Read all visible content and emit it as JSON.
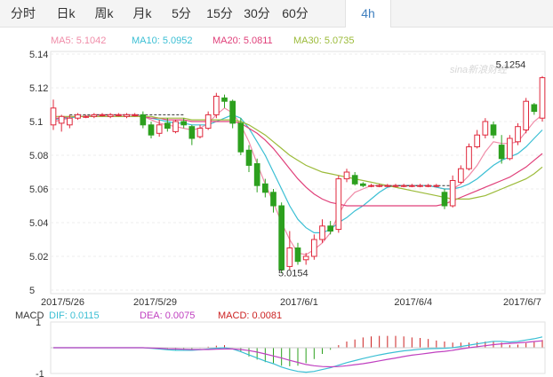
{
  "tabs": [
    "分时",
    "日k",
    "周k",
    "月k",
    "5分",
    "15分",
    "30分",
    "60分",
    "4h"
  ],
  "active_tab": 8,
  "legend": [
    {
      "label": "MA5: 5.1042",
      "color": "#f08ca8"
    },
    {
      "label": "MA10: 5.0952",
      "color": "#3bbfd4"
    },
    {
      "label": "MA20: 5.0811",
      "color": "#e0407a"
    },
    {
      "label": "MA30: 5.0735",
      "color": "#9cbb3a"
    }
  ],
  "macd_legend": [
    {
      "label": "MACD",
      "color": "#333333"
    },
    {
      "label": "DIF: 0.0115",
      "color": "#3bbfd4"
    },
    {
      "label": "DEA: 0.0075",
      "color": "#c040c0"
    },
    {
      "label": "MACD: 0.0081",
      "color": "#cc2222"
    }
  ],
  "watermark": "sina新浪财经",
  "chart_data": {
    "type": "candlestick",
    "y_ticks": [
      "5.14",
      "5.12",
      "5.1",
      "5.08",
      "5.06",
      "5.04",
      "5.02",
      "5"
    ],
    "ylim": [
      5.0,
      5.14
    ],
    "x_ticks": [
      {
        "label": "2017/5/26",
        "index": 0
      },
      {
        "label": "2017/5/29",
        "index": 12
      },
      {
        "label": "2017/6/1",
        "index": 30
      },
      {
        "label": "2017/6/4",
        "index": 44
      },
      {
        "label": "2017/6/7",
        "index": 59
      }
    ],
    "annotations": [
      {
        "label": "5.1254",
        "value": 5.1254,
        "index": 58
      },
      {
        "label": "5.0154",
        "value": 5.0154,
        "index": 30
      }
    ],
    "ref_lines": [
      {
        "value": 5.104,
        "from": 2,
        "to": 16
      },
      {
        "value": 5.062,
        "from": 39,
        "to": 49
      }
    ],
    "candles": [
      [
        5.098,
        5.108,
        5.113,
        5.095
      ],
      [
        5.099,
        5.103,
        5.104,
        5.094
      ],
      [
        5.098,
        5.102,
        5.104,
        5.096
      ],
      [
        5.102,
        5.104,
        5.105,
        5.101
      ],
      [
        5.103,
        5.103,
        5.104,
        5.102
      ],
      [
        5.103,
        5.104,
        5.105,
        5.102
      ],
      [
        5.104,
        5.104,
        5.105,
        5.103
      ],
      [
        5.103,
        5.104,
        5.105,
        5.102
      ],
      [
        5.104,
        5.104,
        5.105,
        5.103
      ],
      [
        5.103,
        5.104,
        5.105,
        5.102
      ],
      [
        5.104,
        5.104,
        5.105,
        5.103
      ],
      [
        5.104,
        5.098,
        5.106,
        5.096
      ],
      [
        5.098,
        5.092,
        5.1,
        5.09
      ],
      [
        5.093,
        5.098,
        5.101,
        5.091
      ],
      [
        5.099,
        5.096,
        5.102,
        5.094
      ],
      [
        5.094,
        5.1,
        5.101,
        5.093
      ],
      [
        5.1,
        5.098,
        5.102,
        5.096
      ],
      [
        5.097,
        5.09,
        5.098,
        5.086
      ],
      [
        5.091,
        5.096,
        5.098,
        5.09
      ],
      [
        5.096,
        5.104,
        5.106,
        5.095
      ],
      [
        5.104,
        5.115,
        5.117,
        5.102
      ],
      [
        5.114,
        5.112,
        5.116,
        5.108
      ],
      [
        5.112,
        5.099,
        5.113,
        5.096
      ],
      [
        5.099,
        5.082,
        5.102,
        5.08
      ],
      [
        5.083,
        5.074,
        5.086,
        5.07
      ],
      [
        5.075,
        5.062,
        5.078,
        5.058
      ],
      [
        5.063,
        5.058,
        5.066,
        5.055
      ],
      [
        5.058,
        5.05,
        5.06,
        5.046
      ],
      [
        5.05,
        5.012,
        5.052,
        5.01
      ],
      [
        5.014,
        5.025,
        5.035,
        5.012
      ],
      [
        5.025,
        5.017,
        5.028,
        5.015
      ],
      [
        5.018,
        5.02,
        5.022,
        5.015
      ],
      [
        5.02,
        5.03,
        5.033,
        5.018
      ],
      [
        5.03,
        5.038,
        5.042,
        5.028
      ],
      [
        5.038,
        5.035,
        5.041,
        5.033
      ],
      [
        5.036,
        5.066,
        5.068,
        5.034
      ],
      [
        5.066,
        5.07,
        5.072,
        5.064
      ],
      [
        5.068,
        5.063,
        5.07,
        5.062
      ],
      [
        5.063,
        5.062,
        5.064,
        5.061
      ],
      [
        5.062,
        5.062,
        5.063,
        5.061
      ],
      [
        5.062,
        5.062,
        5.063,
        5.061
      ],
      [
        5.062,
        5.062,
        5.063,
        5.061
      ],
      [
        5.062,
        5.062,
        5.063,
        5.061
      ],
      [
        5.062,
        5.062,
        5.063,
        5.061
      ],
      [
        5.062,
        5.062,
        5.063,
        5.061
      ],
      [
        5.062,
        5.062,
        5.063,
        5.061
      ],
      [
        5.062,
        5.062,
        5.063,
        5.061
      ],
      [
        5.062,
        5.062,
        5.063,
        5.061
      ],
      [
        5.058,
        5.05,
        5.06,
        5.048
      ],
      [
        5.05,
        5.065,
        5.068,
        5.049
      ],
      [
        5.064,
        5.072,
        5.074,
        5.063
      ],
      [
        5.072,
        5.085,
        5.087,
        5.071
      ],
      [
        5.085,
        5.092,
        5.095,
        5.084
      ],
      [
        5.092,
        5.1,
        5.102,
        5.09
      ],
      [
        5.098,
        5.092,
        5.1,
        5.09
      ],
      [
        5.086,
        5.078,
        5.092,
        5.075
      ],
      [
        5.078,
        5.09,
        5.092,
        5.077
      ],
      [
        5.088,
        5.097,
        5.099,
        5.086
      ],
      [
        5.095,
        5.112,
        5.114,
        5.093
      ],
      [
        5.11,
        5.106,
        5.111,
        5.104
      ],
      [
        5.102,
        5.126,
        5.127,
        5.1
      ]
    ],
    "series": [
      {
        "name": "MA5",
        "color": "#f08ca8",
        "values": [
          5.1,
          5.101,
          5.102,
          5.103,
          5.103,
          5.104,
          5.104,
          5.104,
          5.104,
          5.104,
          5.104,
          5.103,
          5.101,
          5.099,
          5.098,
          5.097,
          5.096,
          5.095,
          5.096,
          5.099,
          5.104,
          5.108,
          5.105,
          5.098,
          5.088,
          5.075,
          5.063,
          5.052,
          5.04,
          5.03,
          5.022,
          5.021,
          5.024,
          5.028,
          5.034,
          5.045,
          5.053,
          5.058,
          5.06,
          5.062,
          5.062,
          5.062,
          5.062,
          5.062,
          5.062,
          5.062,
          5.062,
          5.061,
          5.06,
          5.06,
          5.063,
          5.068,
          5.074,
          5.082,
          5.088,
          5.087,
          5.087,
          5.088,
          5.094,
          5.1,
          5.104
        ]
      },
      {
        "name": "MA10",
        "color": "#3bbfd4",
        "values": [
          5.101,
          5.102,
          5.102,
          5.103,
          5.103,
          5.103,
          5.103,
          5.103,
          5.103,
          5.103,
          5.103,
          5.103,
          5.102,
          5.101,
          5.1,
          5.099,
          5.099,
          5.098,
          5.098,
          5.098,
          5.1,
          5.102,
          5.104,
          5.102,
          5.096,
          5.088,
          5.08,
          5.07,
          5.06,
          5.05,
          5.042,
          5.037,
          5.034,
          5.034,
          5.036,
          5.04,
          5.043,
          5.047,
          5.05,
          5.054,
          5.058,
          5.061,
          5.062,
          5.062,
          5.062,
          5.062,
          5.062,
          5.061,
          5.06,
          5.06,
          5.061,
          5.063,
          5.066,
          5.07,
          5.074,
          5.077,
          5.079,
          5.081,
          5.085,
          5.09,
          5.095
        ]
      },
      {
        "name": "MA20",
        "color": "#e0407a",
        "values": [
          5.102,
          5.102,
          5.103,
          5.103,
          5.103,
          5.103,
          5.103,
          5.103,
          5.103,
          5.103,
          5.103,
          5.103,
          5.102,
          5.102,
          5.101,
          5.101,
          5.101,
          5.1,
          5.1,
          5.1,
          5.1,
          5.1,
          5.1,
          5.099,
          5.096,
          5.093,
          5.089,
          5.084,
          5.078,
          5.072,
          5.066,
          5.061,
          5.057,
          5.054,
          5.052,
          5.051,
          5.05,
          5.05,
          5.05,
          5.05,
          5.05,
          5.05,
          5.05,
          5.05,
          5.05,
          5.05,
          5.05,
          5.05,
          5.051,
          5.053,
          5.055,
          5.057,
          5.059,
          5.061,
          5.063,
          5.065,
          5.067,
          5.07,
          5.073,
          5.077,
          5.081
        ]
      },
      {
        "name": "MA30",
        "color": "#9cbb3a",
        "values": [
          5.103,
          5.103,
          5.103,
          5.103,
          5.103,
          5.103,
          5.103,
          5.103,
          5.103,
          5.103,
          5.103,
          5.103,
          5.103,
          5.102,
          5.102,
          5.102,
          5.102,
          5.101,
          5.101,
          5.101,
          5.101,
          5.101,
          5.101,
          5.1,
          5.098,
          5.095,
          5.092,
          5.088,
          5.084,
          5.08,
          5.077,
          5.074,
          5.072,
          5.07,
          5.069,
          5.068,
          5.067,
          5.066,
          5.065,
          5.064,
          5.063,
          5.062,
          5.061,
          5.06,
          5.059,
          5.058,
          5.057,
          5.056,
          5.055,
          5.054,
          5.054,
          5.054,
          5.055,
          5.056,
          5.058,
          5.06,
          5.062,
          5.064,
          5.066,
          5.069,
          5.073
        ]
      }
    ],
    "macd": {
      "ylim": [
        -1,
        1
      ],
      "y_ticks": [
        "1",
        "-1"
      ],
      "dif": [
        0.0,
        0.0,
        0.0,
        0.0,
        0.0,
        0.0,
        0.0,
        0.0,
        0.0,
        0.0,
        0.0,
        0.0,
        -0.02,
        -0.05,
        -0.08,
        -0.1,
        -0.1,
        -0.1,
        -0.08,
        -0.05,
        -0.02,
        0.0,
        -0.05,
        -0.15,
        -0.28,
        -0.4,
        -0.52,
        -0.62,
        -0.75,
        -0.85,
        -0.92,
        -0.95,
        -0.92,
        -0.85,
        -0.78,
        -0.68,
        -0.58,
        -0.5,
        -0.42,
        -0.35,
        -0.28,
        -0.22,
        -0.17,
        -0.12,
        -0.09,
        -0.06,
        -0.04,
        -0.03,
        -0.02,
        0.0,
        0.05,
        0.1,
        0.15,
        0.2,
        0.25,
        0.25,
        0.22,
        0.25,
        0.3,
        0.35,
        0.42
      ],
      "dea": [
        0.0,
        0.0,
        0.0,
        0.0,
        0.0,
        0.0,
        0.0,
        0.0,
        0.0,
        0.0,
        0.0,
        0.0,
        -0.01,
        -0.02,
        -0.04,
        -0.05,
        -0.06,
        -0.07,
        -0.07,
        -0.07,
        -0.06,
        -0.05,
        -0.05,
        -0.07,
        -0.11,
        -0.17,
        -0.24,
        -0.32,
        -0.4,
        -0.49,
        -0.57,
        -0.65,
        -0.7,
        -0.73,
        -0.74,
        -0.73,
        -0.7,
        -0.66,
        -0.62,
        -0.57,
        -0.51,
        -0.45,
        -0.4,
        -0.34,
        -0.29,
        -0.25,
        -0.21,
        -0.17,
        -0.14,
        -0.1,
        -0.05,
        0.0,
        0.04,
        0.08,
        0.12,
        0.15,
        0.17,
        0.19,
        0.21,
        0.24,
        0.27
      ],
      "hist": [
        0.0,
        0.0,
        0.0,
        0.0,
        0.0,
        0.0,
        0.0,
        0.0,
        0.0,
        0.0,
        0.0,
        0.0,
        -0.02,
        -0.06,
        -0.08,
        -0.1,
        -0.08,
        -0.06,
        -0.02,
        0.04,
        0.08,
        0.1,
        0.0,
        -0.16,
        -0.34,
        -0.46,
        -0.56,
        -0.6,
        -0.7,
        -0.72,
        -0.7,
        -0.6,
        -0.44,
        -0.24,
        -0.08,
        0.1,
        0.24,
        0.32,
        0.4,
        0.44,
        0.46,
        0.46,
        0.46,
        0.44,
        0.4,
        0.38,
        0.34,
        0.28,
        0.24,
        0.2,
        0.2,
        0.2,
        0.22,
        0.24,
        0.26,
        0.2,
        0.1,
        0.12,
        0.18,
        0.22,
        0.3
      ]
    }
  }
}
